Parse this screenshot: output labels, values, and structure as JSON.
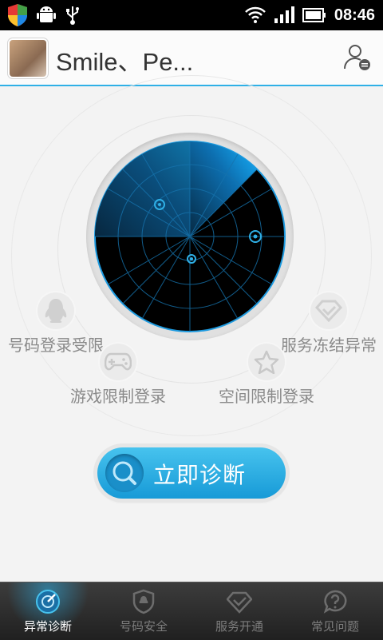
{
  "status_bar": {
    "time": "08:46"
  },
  "header": {
    "title": "Smile、Pe..."
  },
  "features": [
    {
      "label": "号码登录受限",
      "icon": "qq-penguin-icon"
    },
    {
      "label": "服务冻结异常",
      "icon": "diamond-check-icon"
    },
    {
      "label": "游戏限制登录",
      "icon": "gamepad-icon"
    },
    {
      "label": "空间限制登录",
      "icon": "star-icon"
    }
  ],
  "diagnose_button": {
    "label": "立即诊断"
  },
  "tabs": [
    {
      "label": "异常诊断",
      "active": true
    },
    {
      "label": "号码安全",
      "active": false
    },
    {
      "label": "服务开通",
      "active": false
    },
    {
      "label": "常见问题",
      "active": false
    }
  ],
  "colors": {
    "accent": "#2fb0e6",
    "radar_sweep": "#11a9f0",
    "radar_bg": "#000000",
    "tab_bar": "#2a2a2a"
  }
}
